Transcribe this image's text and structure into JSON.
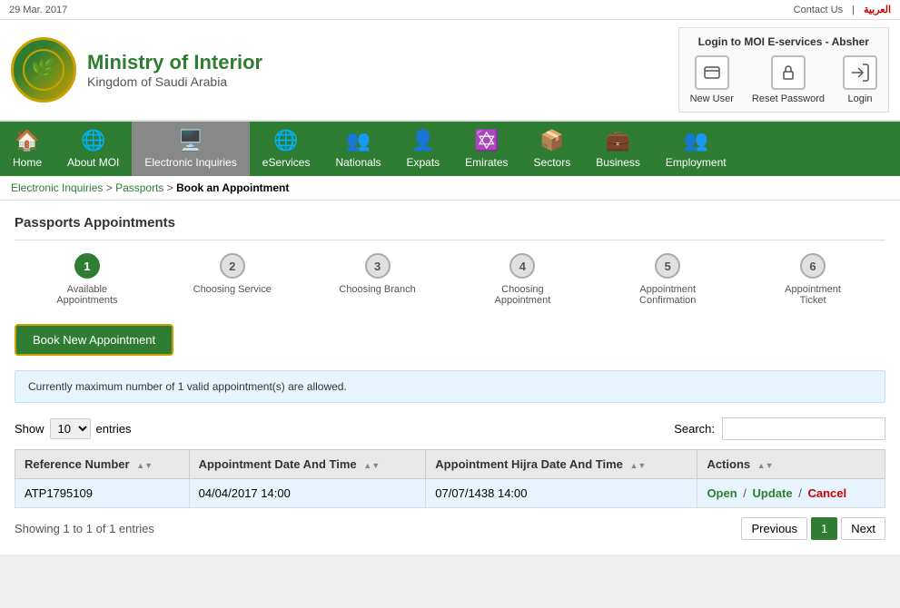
{
  "topbar": {
    "date": "29 Mar. 2017",
    "contact_label": "Contact Us",
    "arabic_label": "العربية",
    "separator": "|"
  },
  "header": {
    "logo_alt": "MOI Logo",
    "title": "Ministry of Interior",
    "subtitle": "Kingdom of Saudi Arabia",
    "login_section_title": "Login to MOI E-services - Absher",
    "new_user_label": "New User",
    "reset_password_label": "Reset Password",
    "login_label": "Login"
  },
  "nav": {
    "items": [
      {
        "id": "home",
        "label": "Home",
        "icon": "🏠"
      },
      {
        "id": "about-moi",
        "label": "About MOI",
        "icon": "🌐"
      },
      {
        "id": "electronic-inquiries",
        "label": "Electronic Inquiries",
        "icon": "🖥️"
      },
      {
        "id": "eservices",
        "label": "eServices",
        "icon": "🌐"
      },
      {
        "id": "nationals",
        "label": "Nationals",
        "icon": "👥"
      },
      {
        "id": "expats",
        "label": "Expats",
        "icon": "👤"
      },
      {
        "id": "emirates",
        "label": "Emirates",
        "icon": "✡️"
      },
      {
        "id": "sectors",
        "label": "Sectors",
        "icon": "📦"
      },
      {
        "id": "business",
        "label": "Business",
        "icon": "💼"
      },
      {
        "id": "employment",
        "label": "Employment",
        "icon": "👥"
      }
    ]
  },
  "breadcrumb": {
    "items": [
      {
        "label": "Electronic Inquiries",
        "href": "#"
      },
      {
        "label": "Passports",
        "href": "#"
      },
      {
        "label": "Book an Appointment",
        "href": ""
      }
    ]
  },
  "page": {
    "title": "Passports Appointments",
    "book_button": "Book New Appointment",
    "info_message": "Currently maximum number of 1 valid appointment(s) are allowed.",
    "show_label": "Show",
    "entries_label": "entries",
    "show_value": "10",
    "search_label": "Search:",
    "search_placeholder": "",
    "showing_text": "Showing 1 to 1 of 1 entries"
  },
  "steps": [
    {
      "number": "1",
      "label": "Available Appointments",
      "active": true
    },
    {
      "number": "2",
      "label": "Choosing Service",
      "active": false
    },
    {
      "number": "3",
      "label": "Choosing Branch",
      "active": false
    },
    {
      "number": "4",
      "label": "Choosing Appointment",
      "active": false
    },
    {
      "number": "5",
      "label": "Appointment Confirmation",
      "active": false
    },
    {
      "number": "6",
      "label": "Appointment Ticket",
      "active": false
    }
  ],
  "table": {
    "columns": [
      {
        "key": "ref",
        "label": "Reference Number"
      },
      {
        "key": "date",
        "label": "Appointment Date And Time"
      },
      {
        "key": "hijra",
        "label": "Appointment Hijra Date And Time"
      },
      {
        "key": "actions",
        "label": "Actions"
      }
    ],
    "rows": [
      {
        "ref": "ATP1795109",
        "date": "04/04/2017 14:00",
        "hijra": "07/07/1438 14:00",
        "actions": {
          "open": "Open",
          "sep1": "/",
          "update": "Update",
          "sep2": "/",
          "cancel": "Cancel"
        }
      }
    ]
  },
  "pagination": {
    "previous_label": "Previous",
    "next_label": "Next",
    "current_page": "1"
  }
}
